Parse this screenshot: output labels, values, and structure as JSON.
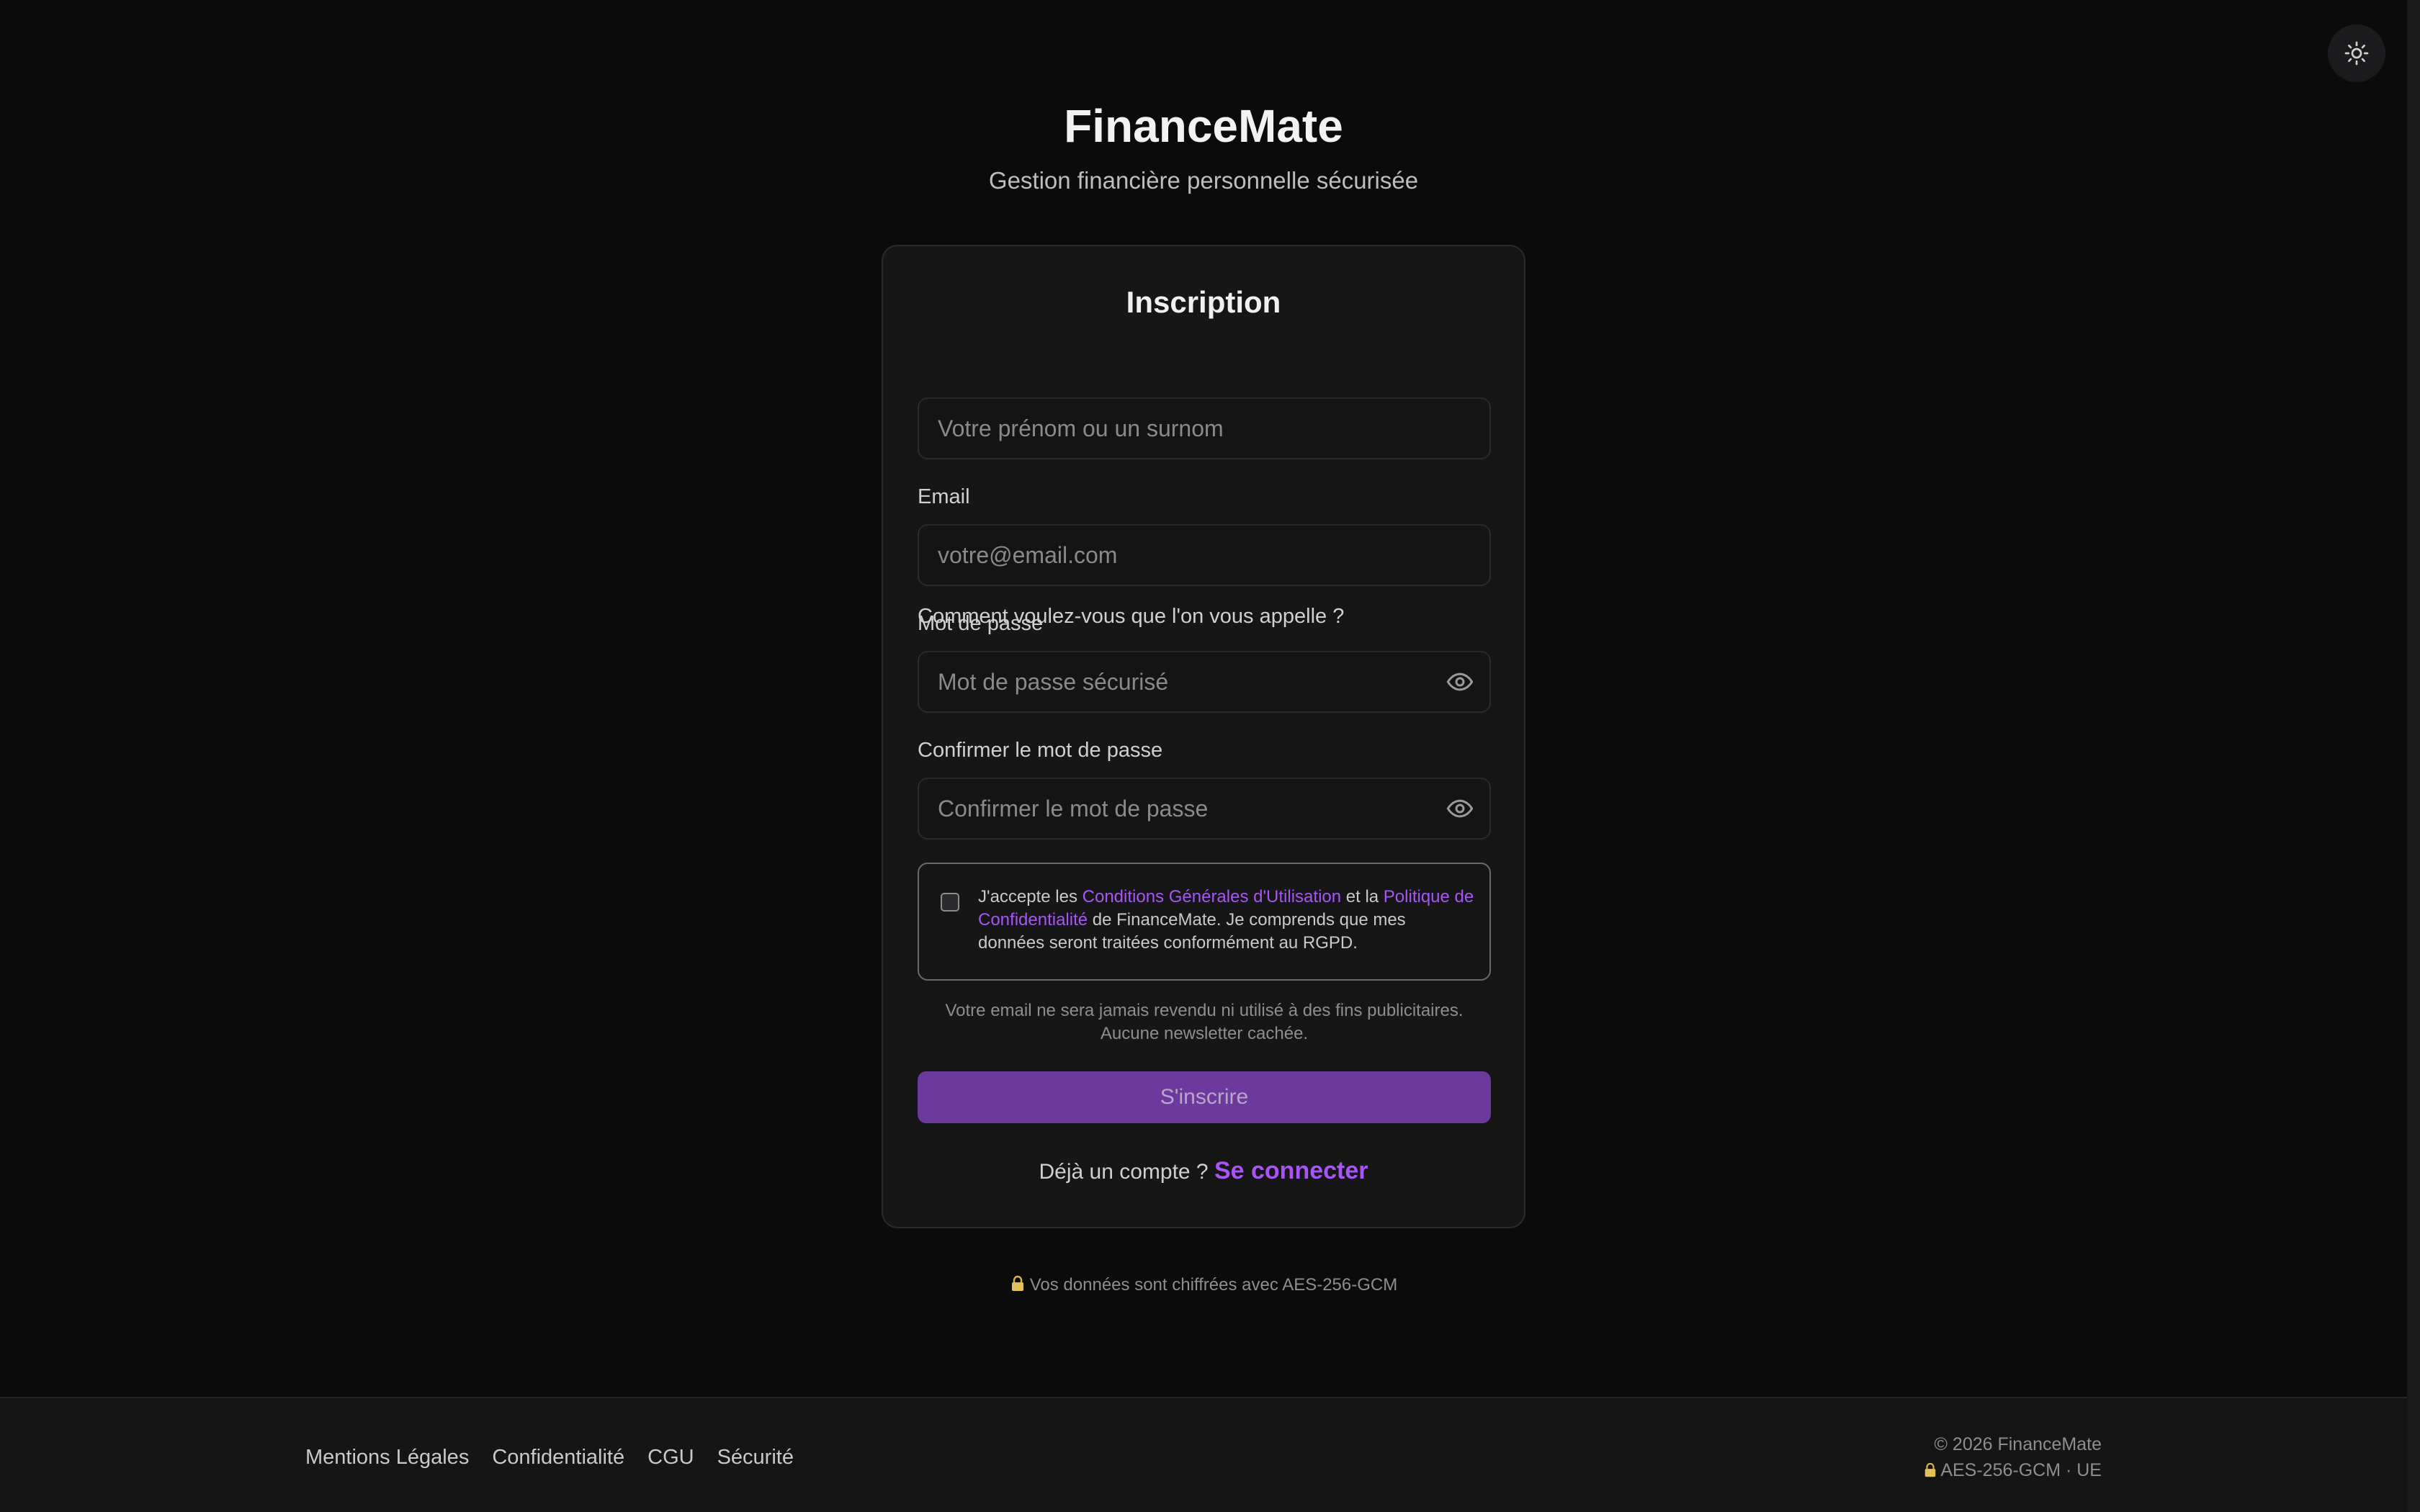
{
  "header": {
    "brand": "FinanceMate",
    "tagline": "Gestion financière personnelle sécurisée"
  },
  "theme_toggle": {
    "icon": "sun-icon"
  },
  "form": {
    "title": "Inscription",
    "name": {
      "label": "Comment voulez-vous que l'on vous appelle ?",
      "placeholder": "Votre prénom ou un surnom",
      "value": ""
    },
    "email": {
      "label": "Email",
      "placeholder": "votre@email.com",
      "value": ""
    },
    "password": {
      "label": "Mot de passe",
      "placeholder": "Mot de passe sécurisé",
      "value": "",
      "icon": "eye-icon"
    },
    "confirm": {
      "label": "Confirmer le mot de passe",
      "placeholder": "Confirmer le mot de passe",
      "value": "",
      "icon": "eye-icon"
    },
    "consent": {
      "checked": false,
      "prefix": "J'accepte les ",
      "cgu_link": "Conditions Générales d'Utilisation",
      "middle": " et la ",
      "privacy_link": "Politique de Confidentialité",
      "suffix": " de FinanceMate. Je comprends que mes données seront traitées conformément au RGPD."
    },
    "privacy_note_line1": "Votre email ne sera jamais revendu ni utilisé à des fins publicitaires.",
    "privacy_note_line2": "Aucune newsletter cachée.",
    "submit_label": "S'inscrire",
    "login_prompt": "Déjà un compte ?",
    "login_link": "Se connecter"
  },
  "encryption_note": "Vos données sont chiffrées avec AES-256-GCM",
  "footer": {
    "links": [
      "Mentions Légales",
      "Confidentialité",
      "CGU",
      "Sécurité"
    ],
    "copyright": "© 2026 FinanceMate",
    "security_badge": "AES-256-GCM · UE"
  },
  "colors": {
    "background": "#0b0b0c",
    "card": "#161617",
    "accent": "#a855f7",
    "button": "#6b3a9c"
  }
}
